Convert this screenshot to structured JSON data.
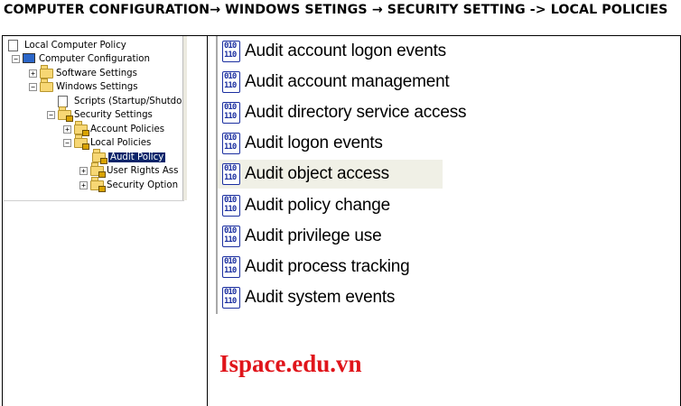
{
  "header": {
    "title": "COMPUTER CONFIGURATION→ WINDOWS SETINGS → SECURITY SETTING -> LOCAL POLICIES"
  },
  "tree": {
    "items": [
      {
        "label": "Local Computer Policy",
        "icon": "policy-icon"
      },
      {
        "label": "Computer Configuration",
        "icon": "computer-icon"
      },
      {
        "label": "Software Settings",
        "icon": "folder-icon"
      },
      {
        "label": "Windows Settings",
        "icon": "folder-icon"
      },
      {
        "label": "Scripts (Startup/Shutdo",
        "icon": "script-icon"
      },
      {
        "label": "Security Settings",
        "icon": "security-icon"
      },
      {
        "label": "Account Policies",
        "icon": "locked-folder-icon"
      },
      {
        "label": "Local Policies",
        "icon": "locked-folder-icon"
      },
      {
        "label": "Audit Policy",
        "icon": "locked-folder-icon",
        "selected": true
      },
      {
        "label": "User Rights Ass",
        "icon": "locked-folder-icon"
      },
      {
        "label": "Security Option",
        "icon": "locked-folder-icon"
      }
    ],
    "expander_collapsed": "+",
    "expander_expanded": "−"
  },
  "list": {
    "icon_digits": "010\n110",
    "items": [
      "Audit account logon events",
      "Audit account management",
      "Audit directory service access",
      "Audit logon events",
      "Audit object access",
      "Audit policy change",
      "Audit privilege use",
      "Audit process tracking",
      "Audit system events"
    ],
    "highlighted_index": 4
  },
  "watermark": {
    "text": "Ispace.edu.vn",
    "color": "#e0151b"
  }
}
